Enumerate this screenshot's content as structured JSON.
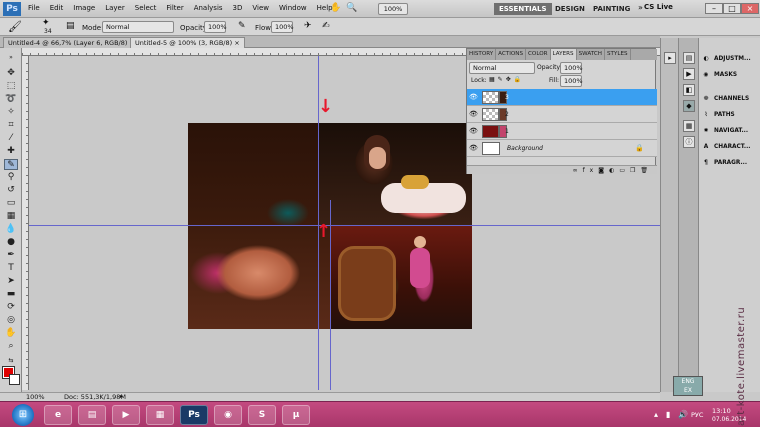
{
  "app": {
    "logo": "Ps"
  },
  "menus": [
    "File",
    "Edit",
    "Image",
    "Layer",
    "Select",
    "Filter",
    "Analysis",
    "3D",
    "View",
    "Window",
    "Help"
  ],
  "topbar": {
    "zoom": "100%",
    "workspaces": [
      "ESSENTIALS",
      "DESIGN",
      "PAINTING"
    ],
    "cslive": "CS Live"
  },
  "options": {
    "brush_size": "34",
    "mode_label": "Mode:",
    "mode_value": "Normal",
    "opacity_label": "Opacity:",
    "opacity_value": "100%",
    "flow_label": "Flow:",
    "flow_value": "100%"
  },
  "tabs": [
    {
      "label": "Untitled-4 @ 66,7% (Layer 6, RGB/8) ×"
    },
    {
      "label": "Untitled-5 @ 100% (3, RGB/8) ×"
    }
  ],
  "status": {
    "zoom": "100%",
    "doc": "Doc: 551,3K/1,98M"
  },
  "panel": {
    "tabs": [
      "HISTORY",
      "ACTIONS",
      "COLOR",
      "LAYERS",
      "SWATCH",
      "STYLES"
    ],
    "blend_mode": "Normal",
    "opacity_label": "Opacity:",
    "opacity_value": "100%",
    "lock_label": "Lock:",
    "fill_label": "Fill:",
    "fill_value": "100%",
    "layers": [
      {
        "name": "3",
        "selected": true
      },
      {
        "name": "2",
        "selected": false
      },
      {
        "name": "1",
        "selected": false
      },
      {
        "name": "Background",
        "selected": false
      }
    ]
  },
  "right_panel": [
    {
      "label": "ADJUSTM...",
      "icon": "adjustments-icon"
    },
    {
      "label": "MASKS",
      "icon": "masks-icon"
    },
    {
      "label": "CHANNELS",
      "icon": "channels-icon"
    },
    {
      "label": "PATHS",
      "icon": "paths-icon"
    },
    {
      "label": "NAVIGAT...",
      "icon": "navigator-icon"
    },
    {
      "label": "CHARACT...",
      "icon": "character-icon"
    },
    {
      "label": "PARAGR...",
      "icon": "paragraph-icon"
    }
  ],
  "taskbar": {
    "language": "РУС",
    "time": "13:10",
    "date": "07.06.2014"
  },
  "watermark": "art-kote.livemaster.ru",
  "badge": "ENG\nEX"
}
